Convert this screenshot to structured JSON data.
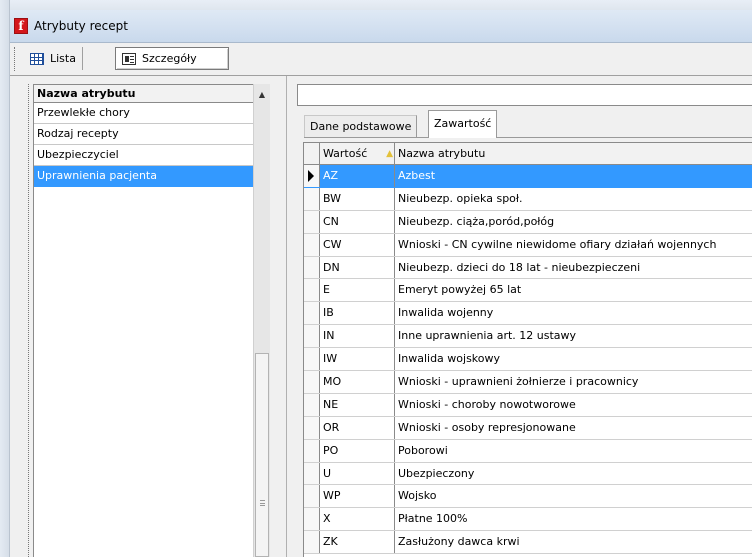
{
  "window": {
    "title": "Atrybuty recept",
    "app_icon_glyph": "f"
  },
  "toolbar": {
    "lista_label": "Lista",
    "szczegoly_label": "Szczegóły"
  },
  "attributes": {
    "header": "Nazwa atrybutu",
    "items": [
      {
        "label": "Przewlekłe chory",
        "selected": false
      },
      {
        "label": "Rodzaj recepty",
        "selected": false
      },
      {
        "label": "Ubezpieczyciel",
        "selected": false
      },
      {
        "label": "Uprawnienia pacjenta",
        "selected": true
      }
    ]
  },
  "search": {
    "value": ""
  },
  "tabs": [
    {
      "label": "Dane podstawowe",
      "active": false
    },
    {
      "label": "Zawartość",
      "active": true
    }
  ],
  "values_table": {
    "columns": [
      "Wartość",
      "Nazwa atrybutu"
    ],
    "rows": [
      {
        "code": "AZ",
        "name": "Azbest",
        "selected": true
      },
      {
        "code": "BW",
        "name": "Nieubezp. opieka społ."
      },
      {
        "code": "CN",
        "name": "Nieubezp. ciąża,poród,połóg"
      },
      {
        "code": "CW",
        "name": "Wnioski - CN cywilne niewidome ofiary działań wojennych"
      },
      {
        "code": "DN",
        "name": "Nieubezp. dzieci do 18 lat - nieubezpieczeni"
      },
      {
        "code": "E",
        "name": "Emeryt powyżej 65 lat"
      },
      {
        "code": "IB",
        "name": "Inwalida wojenny"
      },
      {
        "code": "IN",
        "name": "Inne uprawnienia art. 12 ustawy"
      },
      {
        "code": "IW",
        "name": "Inwalida wojskowy"
      },
      {
        "code": "MO",
        "name": "Wnioski - uprawnieni żołnierze i pracownicy"
      },
      {
        "code": "NE",
        "name": "Wnioski - choroby nowotworowe"
      },
      {
        "code": "OR",
        "name": "Wnioski - osoby represjonowane"
      },
      {
        "code": "PO",
        "name": "Poborowi"
      },
      {
        "code": "U",
        "name": "Ubezpieczony"
      },
      {
        "code": "WP",
        "name": "Wojsko"
      },
      {
        "code": "X",
        "name": "Płatne 100%"
      },
      {
        "code": "ZK",
        "name": "Zasłużony dawca krwi"
      }
    ]
  },
  "colors": {
    "selection": "#3399ff",
    "app_icon": "#d4161b",
    "sort_glyph": "#e3c13a"
  }
}
